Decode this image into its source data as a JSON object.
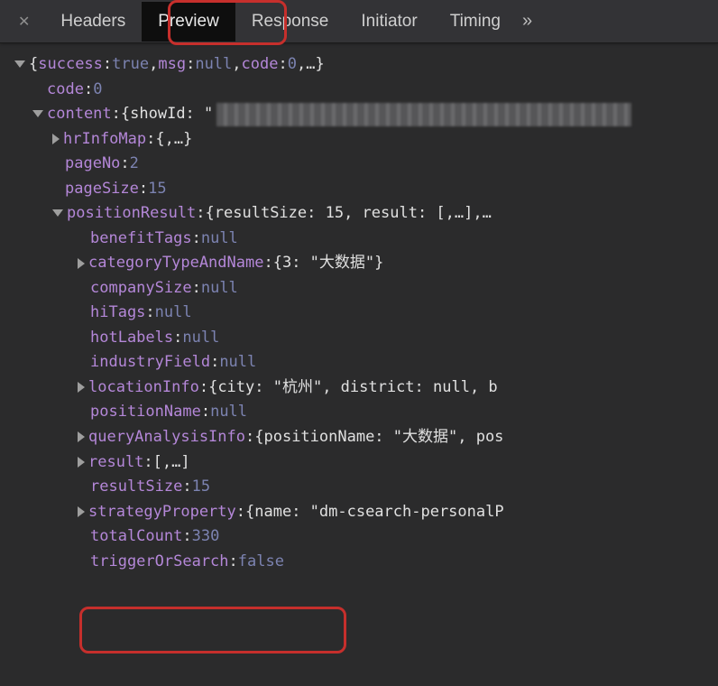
{
  "tabs": {
    "headers": "Headers",
    "preview": "Preview",
    "response": "Response",
    "initiator": "Initiator",
    "timing": "Timing",
    "overflow": "»"
  },
  "root": {
    "summary_open": "{",
    "summary_k1": "success",
    "summary_v1": "true",
    "summary_k2": "msg",
    "summary_v2": "null",
    "summary_k3": "code",
    "summary_v3": "0",
    "summary_close": ",…}",
    "code_k": "code",
    "code_v": "0",
    "content_k": "content",
    "content_v": "{showId: \"",
    "hrInfoMap_k": "hrInfoMap",
    "hrInfoMap_v": "{,…}",
    "pageNo_k": "pageNo",
    "pageNo_v": "2",
    "pageSize_k": "pageSize",
    "pageSize_v": "15",
    "positionResult_k": "positionResult",
    "positionResult_v": "{resultSize: 15, result: [,…],…",
    "benefitTags_k": "benefitTags",
    "benefitTags_v": "null",
    "categoryTypeAndName_k": "categoryTypeAndName",
    "categoryTypeAndName_v": "{3: \"大数据\"}",
    "companySize_k": "companySize",
    "companySize_v": "null",
    "hiTags_k": "hiTags",
    "hiTags_v": "null",
    "hotLabels_k": "hotLabels",
    "hotLabels_v": "null",
    "industryField_k": "industryField",
    "industryField_v": "null",
    "locationInfo_k": "locationInfo",
    "locationInfo_v": "{city: \"杭州\", district: null, b",
    "positionName_k": "positionName",
    "positionName_v": "null",
    "queryAnalysisInfo_k": "queryAnalysisInfo",
    "queryAnalysisInfo_v": "{positionName: \"大数据\", pos",
    "result_k": "result",
    "result_v": "[,…]",
    "resultSize_k": "resultSize",
    "resultSize_v": "15",
    "strategyProperty_k": "strategyProperty",
    "strategyProperty_v": "{name: \"dm-csearch-personalP",
    "totalCount_k": "totalCount",
    "totalCount_v": "330",
    "triggerOrSearch_k": "triggerOrSearch",
    "triggerOrSearch_v": "false"
  }
}
